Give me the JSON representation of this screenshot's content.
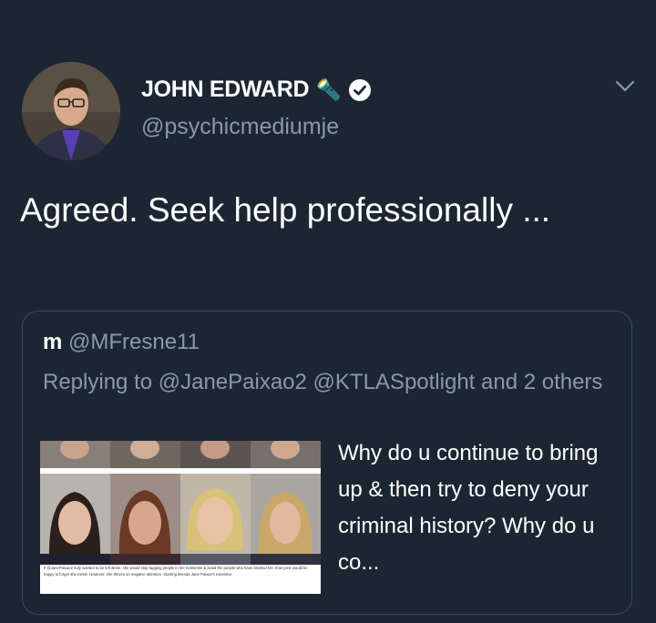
{
  "author": {
    "display_name": "JOHN EDWARD",
    "handle": "@psychicmediumje",
    "emoji": "🔦"
  },
  "tweet": {
    "text": "Agreed.  Seek help professionally ..."
  },
  "quoted_tweet": {
    "display_name": "m",
    "handle": "@MFresne11",
    "replying_to": "Replying to @JanePaixao2 @KTLASpotlight and 2 others",
    "text": "Why do u continue to bring up & then try to deny your criminal history? Why do u co...",
    "media_caption": "If @JanePaixao2 truly wanted to be left alone, she would stop tagging people in her nonsense & avoid the people who have blocked her. Everyone would be happy to forget she exists. However, she thrives on negative attention. Starring Brenda Jane Paixao's extensive"
  },
  "colors": {
    "background": "#1c2633",
    "secondary_text": "#8b98a5",
    "border": "#3d4957"
  }
}
